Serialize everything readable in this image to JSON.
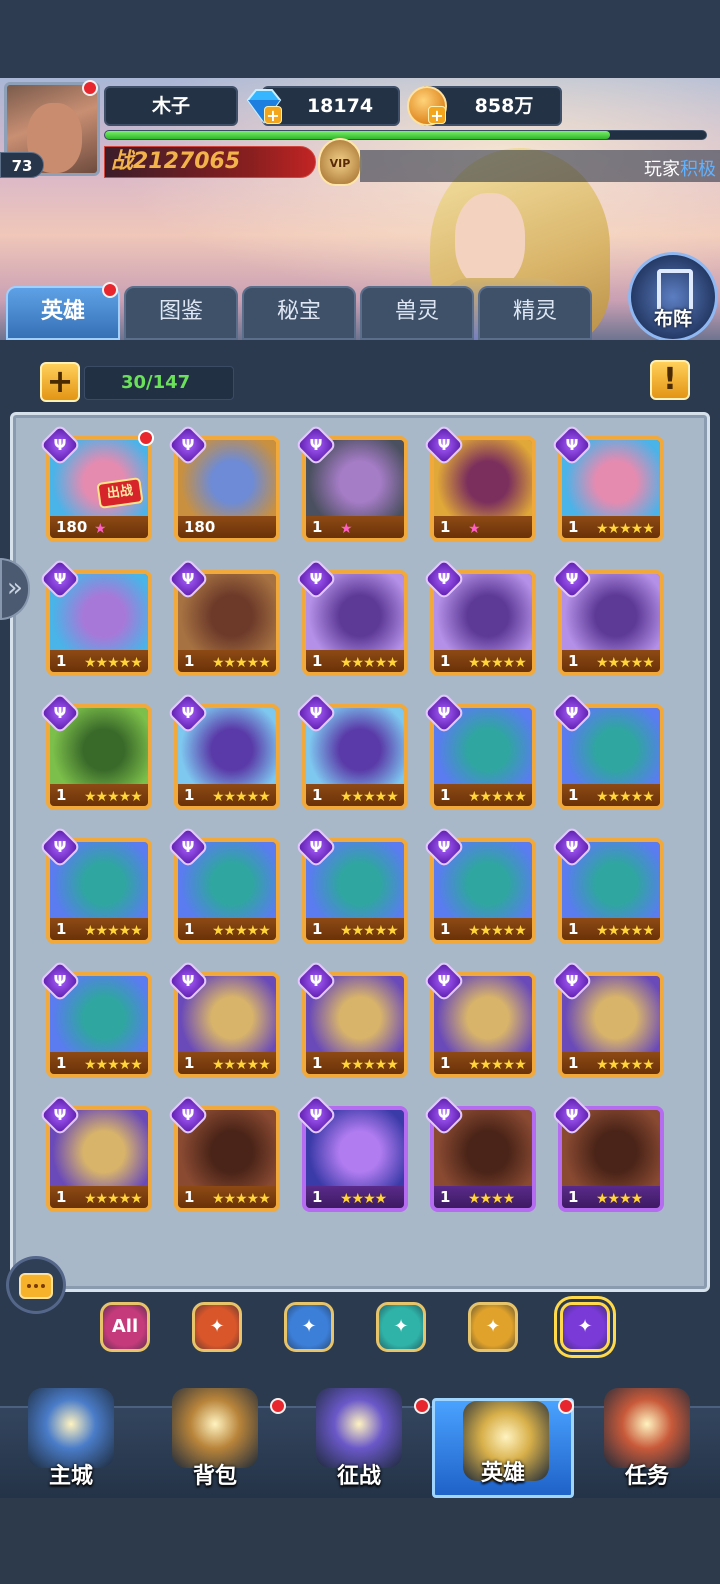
{
  "player": {
    "name": "木子",
    "level": "73",
    "power": "战2127065",
    "diamonds": "18174",
    "gold": "858万",
    "vip": "VIP",
    "xp_fraction": 0.84
  },
  "ticker": {
    "prefix": "玩家",
    "highlight": "积极"
  },
  "tabs": [
    {
      "label": "英雄",
      "active": true,
      "dot": true
    },
    {
      "label": "图鉴"
    },
    {
      "label": "秘宝"
    },
    {
      "label": "兽灵"
    },
    {
      "label": "精灵"
    }
  ],
  "formation_label": "布阵",
  "hero_count": "30/147",
  "cards": [
    {
      "level": "180",
      "stars": "★",
      "star_color": "pink",
      "tag": "出战",
      "dot": true,
      "theme": [
        "#4ab3e8",
        "#e58bb0"
      ]
    },
    {
      "level": "180",
      "stars": "",
      "theme": [
        "#c9903f",
        "#6d8bd6"
      ]
    },
    {
      "level": "1",
      "stars": "★",
      "star_color": "pink",
      "theme": [
        "#4b5060",
        "#a57cc6"
      ]
    },
    {
      "level": "1",
      "stars": "★",
      "star_color": "pink",
      "theme": [
        "#e0a838",
        "#7b2f5d"
      ]
    },
    {
      "level": "1",
      "stars": "★★★★★",
      "theme": [
        "#4ab3e8",
        "#e58bb0"
      ]
    },
    {
      "level": "1",
      "stars": "★★★★★",
      "theme": [
        "#4ab3e8",
        "#a878d8"
      ]
    },
    {
      "level": "1",
      "stars": "★★★★★",
      "theme": [
        "#a67242",
        "#6d3a2a"
      ]
    },
    {
      "level": "1",
      "stars": "★★★★★",
      "theme": [
        "#b490e8",
        "#5d3a96"
      ]
    },
    {
      "level": "1",
      "stars": "★★★★★",
      "theme": [
        "#b490e8",
        "#5d3a96"
      ]
    },
    {
      "level": "1",
      "stars": "★★★★★",
      "theme": [
        "#b490e8",
        "#5d3a96"
      ]
    },
    {
      "level": "1",
      "stars": "★★★★★",
      "theme": [
        "#7cbf4a",
        "#3a6a2a"
      ]
    },
    {
      "level": "1",
      "stars": "★★★★★",
      "theme": [
        "#7ec8f0",
        "#5a3aa8"
      ]
    },
    {
      "level": "1",
      "stars": "★★★★★",
      "theme": [
        "#7ec8f0",
        "#5a3aa8"
      ]
    },
    {
      "level": "1",
      "stars": "★★★★★",
      "theme": [
        "#5a7cf0",
        "#2fa6a0"
      ]
    },
    {
      "level": "1",
      "stars": "★★★★★",
      "theme": [
        "#5a7cf0",
        "#2fa6a0"
      ]
    },
    {
      "level": "1",
      "stars": "★★★★★",
      "theme": [
        "#5a7cf0",
        "#2fa6a0"
      ]
    },
    {
      "level": "1",
      "stars": "★★★★★",
      "theme": [
        "#5a7cf0",
        "#2fa6a0"
      ]
    },
    {
      "level": "1",
      "stars": "★★★★★",
      "theme": [
        "#5a7cf0",
        "#2fa6a0"
      ]
    },
    {
      "level": "1",
      "stars": "★★★★★",
      "theme": [
        "#5a7cf0",
        "#2fa6a0"
      ]
    },
    {
      "level": "1",
      "stars": "★★★★★",
      "theme": [
        "#5a7cf0",
        "#2fa6a0"
      ]
    },
    {
      "level": "1",
      "stars": "★★★★★",
      "theme": [
        "#5a7cf0",
        "#2fa6a0"
      ]
    },
    {
      "level": "1",
      "stars": "★★★★★",
      "theme": [
        "#6a4ab8",
        "#d8b46a"
      ]
    },
    {
      "level": "1",
      "stars": "★★★★★",
      "theme": [
        "#6a4ab8",
        "#d8b46a"
      ]
    },
    {
      "level": "1",
      "stars": "★★★★★",
      "theme": [
        "#6a4ab8",
        "#d8b46a"
      ]
    },
    {
      "level": "1",
      "stars": "★★★★★",
      "theme": [
        "#6a4ab8",
        "#d8b46a"
      ]
    },
    {
      "level": "1",
      "stars": "★★★★★",
      "theme": [
        "#6a4ab8",
        "#d8b46a"
      ]
    },
    {
      "level": "1",
      "stars": "★★★★★",
      "theme": [
        "#8a4a32",
        "#4a2418"
      ]
    },
    {
      "level": "1",
      "stars": "★★★★",
      "purple": true,
      "theme": [
        "#3a3aa8",
        "#b07cf0"
      ]
    },
    {
      "level": "1",
      "stars": "★★★★",
      "purple": true,
      "theme": [
        "#8a4a32",
        "#4a2418"
      ]
    },
    {
      "level": "1",
      "stars": "★★★★",
      "purple": true,
      "theme": [
        "#8a4a32",
        "#4a2418"
      ]
    }
  ],
  "filters": [
    {
      "label": "All",
      "icon": "all-filter-icon",
      "color": "#c43a7a"
    },
    {
      "label": "",
      "icon": "fire-faction-icon",
      "color": "#d9562a"
    },
    {
      "label": "",
      "icon": "cross-faction-icon",
      "color": "#3c7fd8"
    },
    {
      "label": "",
      "icon": "skull-faction-icon",
      "color": "#2fb3a8"
    },
    {
      "label": "",
      "icon": "wing-faction-icon",
      "color": "#e0a22a"
    },
    {
      "label": "",
      "icon": "trident-faction-icon",
      "color": "#7a3ad8",
      "selected": true
    }
  ],
  "nav": [
    {
      "label": "主城",
      "icon": "castle-icon",
      "color": "#4a7cc8",
      "dot": false
    },
    {
      "label": "背包",
      "icon": "chest-icon",
      "color": "#b8843a",
      "dot": true
    },
    {
      "label": "征战",
      "icon": "dragon-portal-icon",
      "color": "#6a58c8",
      "dot": true
    },
    {
      "label": "英雄",
      "icon": "helmet-icon",
      "color": "#d8b04a",
      "dot": true,
      "active": true
    },
    {
      "label": "任务",
      "icon": "scroll-icon",
      "color": "#c85a3a",
      "dot": false
    }
  ]
}
